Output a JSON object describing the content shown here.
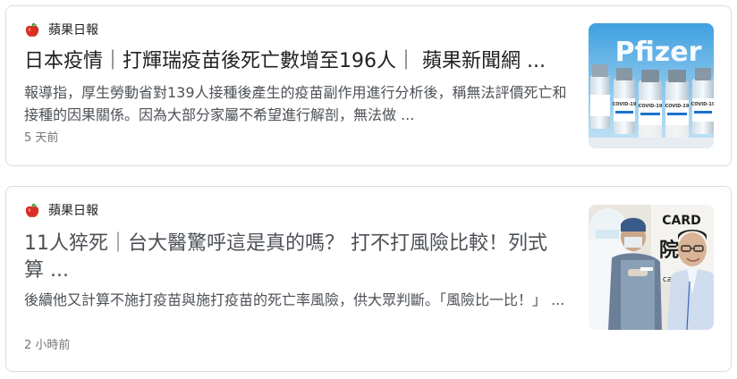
{
  "results": [
    {
      "source": "蘋果日報",
      "source_icon": "apple-daily-logo-icon",
      "title": "日本疫情｜打輝瑞疫苗後死亡數增至196人｜ 蘋果新聞網 ...",
      "snippet": "報導指，厚生勞動省對139人接種後產生的疫苗副作用進行分析後，稱無法評價死亡和接種的因果關係。因為大部分家屬不希望進行解剖，無法做 ...",
      "age": "5 天前",
      "thumbnail": {
        "brand_text": "Pfizer",
        "vial_label": "COVID-19",
        "accent_color": "#1a73c9"
      }
    },
    {
      "source": "蘋果日報",
      "source_icon": "apple-daily-logo-icon",
      "title": "11人猝死｜台大醫驚呼這是真的嗎？ 打不打風險比較！列式算 ...",
      "snippet": "後續他又計算不施打疫苗與施打疫苗的死亡率風險，供大眾判斷。「風險比一比！」 ...",
      "age": "2 小時前",
      "thumbnail": {
        "sign_text_top": "CARD",
        "sign_text_mid": "院",
        "sign_text_bottom": "cal Tri"
      }
    }
  ],
  "colors": {
    "title": "#202124",
    "snippet": "#4d5156",
    "meta": "#70757a",
    "border": "#dadce0",
    "apple_red": "#d93025"
  }
}
